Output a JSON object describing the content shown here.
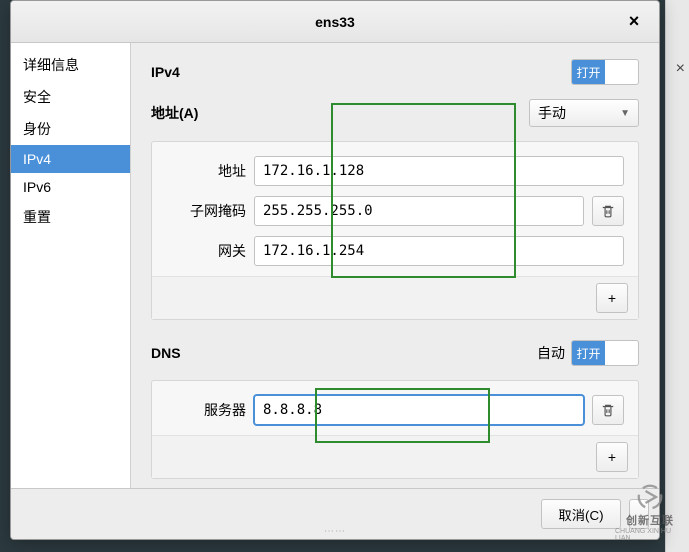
{
  "window": {
    "title": "ens33",
    "close_glyph": "×"
  },
  "sidebar": {
    "items": [
      {
        "label": "详细信息",
        "selected": false
      },
      {
        "label": "安全",
        "selected": false
      },
      {
        "label": "身份",
        "selected": false
      },
      {
        "label": "IPv4",
        "selected": true
      },
      {
        "label": "IPv6",
        "selected": false
      },
      {
        "label": "重置",
        "selected": false
      }
    ]
  },
  "ipv4": {
    "header": "IPv4",
    "toggle_on_label": "打开",
    "address_section_label": "地址(A)",
    "method_selected": "手动",
    "rows": {
      "address_label": "地址",
      "netmask_label": "子网掩码",
      "gateway_label": "网关",
      "address_value": "172.16.1.128",
      "netmask_value": "255.255.255.0",
      "gateway_value": "172.16.1.254"
    }
  },
  "dns": {
    "header": "DNS",
    "auto_label": "自动",
    "toggle_on_label": "打开",
    "server_label": "服务器",
    "server_value": "8.8.8.8"
  },
  "footer": {
    "cancel_label": "取消(C)"
  },
  "icons": {
    "trash": "trash-icon",
    "plus": "+",
    "chevron_down": "▼"
  },
  "watermark": {
    "line1": "创新互联",
    "line2": "CHUANG XIN HU LIAN"
  }
}
